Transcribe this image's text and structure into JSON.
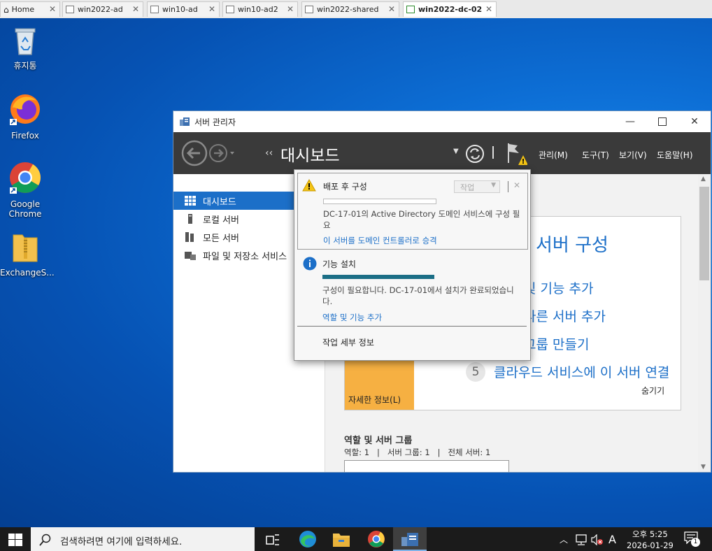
{
  "vm_tabs": [
    {
      "label": "Home",
      "active": false
    },
    {
      "label": "win2022-ad",
      "active": false
    },
    {
      "label": "win10-ad",
      "active": false
    },
    {
      "label": "win10-ad2",
      "active": false
    },
    {
      "label": "win2022-shared",
      "active": false
    },
    {
      "label": "win2022-dc-02",
      "active": true
    }
  ],
  "desktop_icons": [
    {
      "label": "휴지통",
      "icon": "recycle-bin-icon"
    },
    {
      "label": "Firefox",
      "icon": "firefox-icon"
    },
    {
      "label": "Google Chrome",
      "icon": "chrome-icon"
    },
    {
      "label": "ExchangeS...",
      "icon": "zip-folder-icon"
    }
  ],
  "window": {
    "title": "서버 관리자",
    "breadcrumb_arrows": "‹‹",
    "page_title": "대시보드",
    "menu": [
      "관리(M)",
      "도구(T)",
      "보기(V)",
      "도움말(H)"
    ]
  },
  "sidebar": {
    "items": [
      {
        "label": "대시보드",
        "selected": true
      },
      {
        "label": "로컬 서버",
        "selected": false
      },
      {
        "label": "모든 서버",
        "selected": false
      },
      {
        "label": "파일 및 저장소 서비스",
        "selected": false
      }
    ]
  },
  "welcome": {
    "title": "서버 구성",
    "steps": [
      {
        "num": "",
        "text": "및 기능 추가"
      },
      {
        "num": "",
        "text": "다른 서버 추가"
      },
      {
        "num": "",
        "text": "그룹 만들기"
      },
      {
        "num": "5",
        "text": "클라우드 서비스에 이 서버 연결"
      }
    ],
    "hide_label": "숨기기",
    "learn_more": "자세한 정보(L)",
    "roles_heading": "역할 및 서버 그룹",
    "roles_summary": "역할: 1   |   서버 그룹: 1   |   전체 서버: 1"
  },
  "notifications": {
    "post_deploy": {
      "title": "배포 후 구성",
      "task_button": "작업",
      "message": "DC-17-01의 Active Directory 도메인 서비스에 구성 필요",
      "link": "이 서버를 도메인 컨트롤러로 승격",
      "progress": 0
    },
    "feature_install": {
      "title": "기능 설치",
      "message": "구성이 필요합니다. DC-17-01에서 설치가 완료되었습니다.",
      "link": "역할 및 기능 추가",
      "progress": 1.0
    },
    "task_details": "작업 세부 정보"
  },
  "taskbar": {
    "search_placeholder": "검색하려면 여기에 입력하세요.",
    "time": "오후 5:25",
    "date": "2026-01-29",
    "ime": "A",
    "notification_count": "1"
  },
  "colors": {
    "accent": "#1c6fc8",
    "warning": "#f4c414",
    "learn_more_bg": "#f6b042"
  }
}
